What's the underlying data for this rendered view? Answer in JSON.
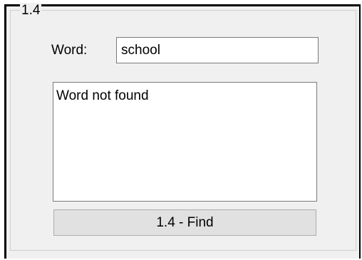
{
  "group": {
    "title": "1.4"
  },
  "word_field": {
    "label": "Word:",
    "value": "school"
  },
  "output": {
    "text": "Word not found"
  },
  "find_button": {
    "label": "1.4 - Find"
  }
}
